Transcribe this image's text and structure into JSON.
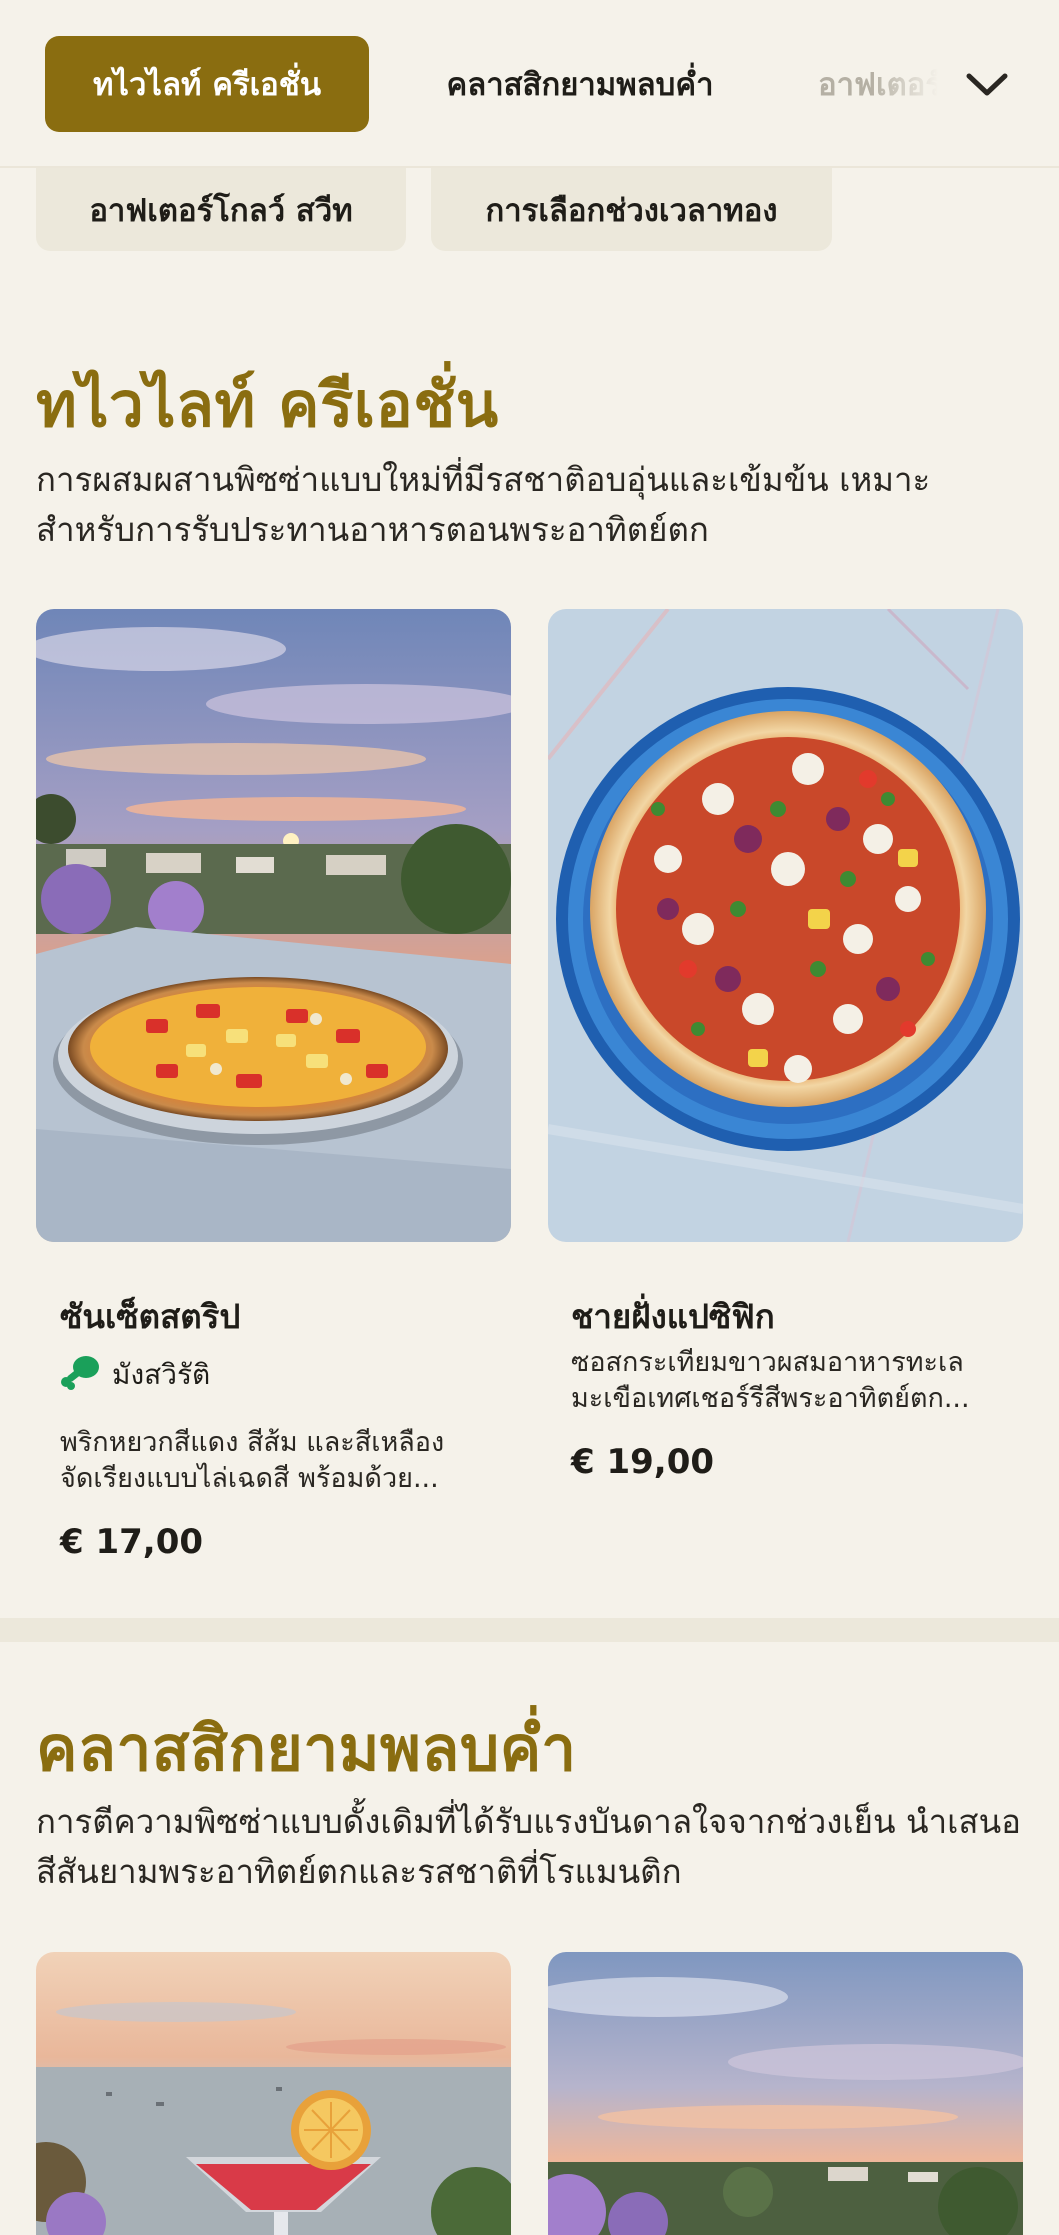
{
  "nav": {
    "tabs": [
      {
        "label": "ทไวไลท์ ครีเอชั่น",
        "active": true
      },
      {
        "label": "คลาสสิกยามพลบค่ำ",
        "active": false
      },
      {
        "label": "อาฟเตอร์โกลว์ สวีท",
        "active": false
      }
    ],
    "chips": [
      {
        "label": "อาฟเตอร์โกลว์ สวีท"
      },
      {
        "label": "การเลือกช่วงเวลาทอง"
      }
    ],
    "expand_icon": "chevron-down-icon"
  },
  "sections": [
    {
      "title": "ทไวไลท์ ครีเอชั่น",
      "description": "การผสมผสานพิซซ่าแบบใหม่ที่มีรสชาติอบอุ่นและเข้มข้น เหมาะสำหรับการรับประทานอาหารตอนพระอาทิตย์ตก",
      "items": [
        {
          "name": "ซันเซ็ตสตริป",
          "badge": "มังสวิรัติ",
          "badge_icon": "vegetarian-drumstick-icon",
          "description": "พริกหยวกสีแดง สีส้ม และสีเหลือง จัดเรียงแบบไล่เฉดสี พร้อมด้วย...",
          "price": "€ 17,00"
        },
        {
          "name": "ชายฝั่งแปซิฟิก",
          "description": "ซอสกระเทียมขาวผสมอาหารทะเล มะเขือเทศเชอร์รีสีพระอาทิตย์ตก...",
          "price": "€ 19,00"
        }
      ]
    },
    {
      "title": "คลาสสิกยามพลบค่ำ",
      "description": "การตีความพิซซ่าแบบดั้งเดิมที่ได้รับแรงบันดาลใจจากช่วงเย็น นำเสนอสีสันยามพระอาทิตย์ตกและรสชาติที่โรแมนติก"
    }
  ],
  "colors": {
    "accent": "#8a6d10",
    "background": "#f5f2ea",
    "chip": "#ece8db",
    "veg_green": "#1aa05a"
  }
}
